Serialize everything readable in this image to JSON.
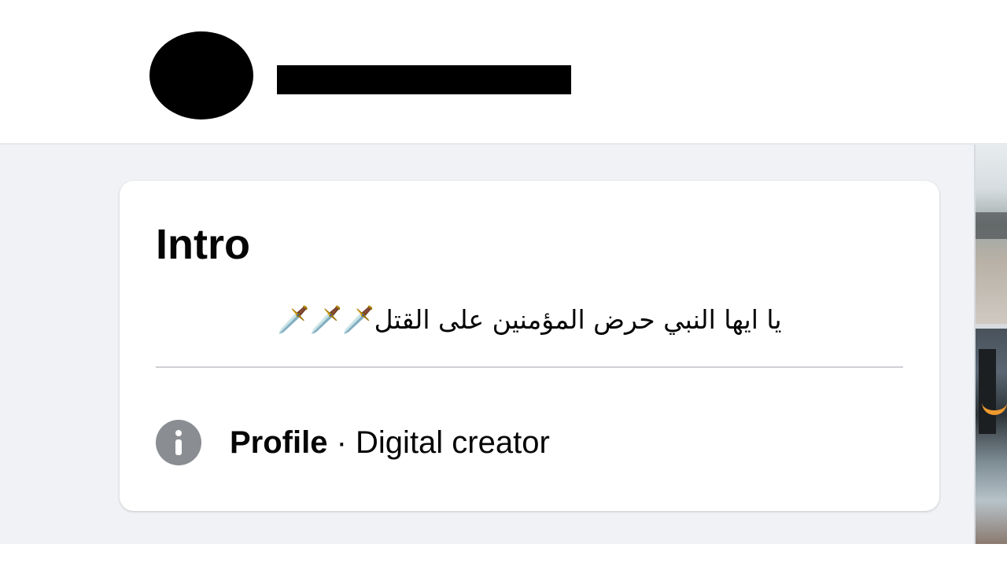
{
  "header": {
    "avatar_icon": "redacted-avatar",
    "profile_name_redacted": true
  },
  "intro": {
    "title": "Intro",
    "bio": "يا ايها النبي حرض المؤمنين على القتل🗡️🗡️🗡️"
  },
  "details": {
    "info_icon": "info-icon",
    "category_label": "Profile",
    "separator": " · ",
    "category_value": "Digital creator"
  },
  "colors": {
    "page_background": "#f0f2f5",
    "card_background": "#ffffff",
    "text_primary": "#050505",
    "icon_gray": "#8a8d91",
    "divider": "#ced0d4"
  }
}
